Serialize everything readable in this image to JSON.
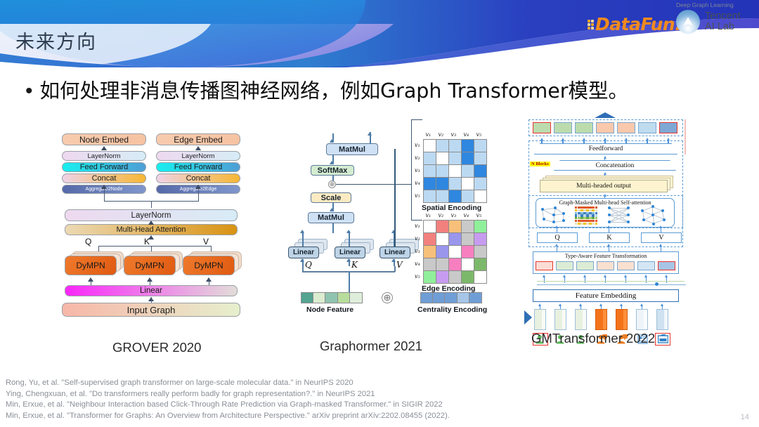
{
  "slide": {
    "title": "未来方向",
    "page_number": "14",
    "bullet_marker": "•",
    "bullet_text": "如何处理非消息传播图神经网络，例如Graph Transformer模型。"
  },
  "branding": {
    "datafun": {
      "name": "DataFun.",
      "lead": "D",
      "rest": "ataFun.",
      "color": "#f08a1e"
    },
    "tencent": {
      "tagline": "Deep Graph Learning",
      "line1": "Tencent",
      "line2": "AI Lab"
    }
  },
  "figures": {
    "grover": {
      "caption": "GROVER 2020",
      "left_column": [
        "Node Embed",
        "LayerNorm",
        "Feed Forward",
        "Concat",
        "Aggregate2Node"
      ],
      "right_column": [
        "Edge Embed",
        "LayerNorm",
        "Feed Forward",
        "Concat",
        "Aggregate2Edge"
      ],
      "shared": [
        "LayerNorm",
        "Multi-Head Attention"
      ],
      "qkv_labels": [
        "Q",
        "K",
        "V"
      ],
      "dympn": [
        "DyMPN",
        "DyMPN",
        "DyMPN"
      ],
      "linear": "Linear",
      "input": "Input Graph"
    },
    "graphormer": {
      "caption": "Graphormer 2021",
      "ops": [
        "MatMul",
        "SoftMax",
        "Scale",
        "MatMul"
      ],
      "linear_boxes": [
        "Linear",
        "Linear",
        "Linear"
      ],
      "qkv_labels": [
        "Q",
        "K",
        "V"
      ],
      "plus_symbols": [
        "⊕",
        "⊕"
      ],
      "node_feature_label": "Node Feature",
      "centrality_label": "Centrality Encoding",
      "spatial": {
        "caption": "Spatial Encoding",
        "row_labels": [
          "v₁",
          "v₂",
          "v₃",
          "v₄",
          "v₅"
        ],
        "col_labels": [
          "v₁",
          "v₂",
          "v₃",
          "v₄",
          "v₅"
        ],
        "cells": [
          [
            "#ffffff",
            "#bcd9f2",
            "#bcd9f2",
            "#2f87e0",
            "#bcd9f2"
          ],
          [
            "#bcd9f2",
            "#ffffff",
            "#bcd9f2",
            "#2f87e0",
            "#bcd9f2"
          ],
          [
            "#bcd9f2",
            "#bcd9f2",
            "#ffffff",
            "#bcd9f2",
            "#2f87e0"
          ],
          [
            "#2f87e0",
            "#2f87e0",
            "#bcd9f2",
            "#ffffff",
            "#bcd9f2"
          ],
          [
            "#bcd9f2",
            "#bcd9f2",
            "#2f87e0",
            "#bcd9f2",
            "#ffffff"
          ]
        ]
      },
      "edge": {
        "caption": "Edge Encoding",
        "row_labels": [
          "v₁",
          "v₂",
          "v₃",
          "v₄",
          "v₅"
        ],
        "col_labels": [
          "v₁",
          "v₂",
          "v₃",
          "v₄",
          "v₅"
        ],
        "cells": [
          [
            "#ffffff",
            "#f2807e",
            "#f7c07a",
            "#c9c9c9",
            "#90ef9a"
          ],
          [
            "#f2807e",
            "#ffffff",
            "#9a96ec",
            "#c9c9c9",
            "#c79cf0"
          ],
          [
            "#f7c07a",
            "#9a96ec",
            "#ffffff",
            "#f77fc0",
            "#c9c9c9"
          ],
          [
            "#c9c9c9",
            "#c9c9c9",
            "#f77fc0",
            "#ffffff",
            "#7cb86a"
          ],
          [
            "#90ef9a",
            "#c79cf0",
            "#c9c9c9",
            "#7cb86a",
            "#ffffff"
          ]
        ]
      },
      "node_feature_colors": [
        "#55a391",
        "#dcecd0",
        "#8fc4b0",
        "#b7dd9c",
        "#dfeedb"
      ],
      "centrality_colors": [
        "#6f9ed6",
        "#6f9ed6",
        "#6f9ed6",
        "#a6c6e8",
        "#6f9ed6"
      ]
    },
    "gmtransformer": {
      "caption": "GMTransformer 2022",
      "output_cells": [
        "#bcdcae",
        "#bcdcae",
        "#bcdcae",
        "#fac8ac",
        "#fac8ac",
        "#bfdcef",
        "#7fa8d4"
      ],
      "output_highlight": [
        0,
        6
      ],
      "feedforward": "Feedforward",
      "n_blocks": "N Blocks",
      "concatenation": "Concatenation",
      "multi_headed_output": "Multi-headed output",
      "attention_title": "Graph-Masked Multi-head Self-attention",
      "qkv": [
        "Q",
        "K",
        "V"
      ],
      "type_aware": "Type-Aware Feature Transformation",
      "type_cells": [
        "#fadcd4",
        "#dcecd4",
        "#dcecd4",
        "#fae0d0",
        "#fae0d0",
        "#d4e6f4",
        "#a8c4e4"
      ],
      "type_highlight": [
        0,
        6
      ],
      "feature_embedding": "Feature Embedding",
      "bars": [
        "#e8f0df",
        "#e8f0df",
        "#e8f0df",
        "#f4731a",
        "#f4731a",
        "#eef4fa",
        "#cfe2f2"
      ],
      "icon_names": [
        "user-icon",
        "user-icon",
        "user-icon",
        "user-chat-icon",
        "user-chat-icon",
        "news-icon",
        "ad-icon"
      ],
      "icon_colors": [
        "#5cb85c",
        "#5cb85c",
        "#5cb85c",
        "#ef7d22",
        "#ef7d22",
        "#5b9bd5",
        "#2f7fc4"
      ],
      "icon_highlight": [
        0,
        6
      ]
    }
  },
  "references": [
    "Rong, Yu, et al. \"Self-supervised graph transformer on large-scale molecular data.\" in NeurIPS 2020",
    "Ying, Chengxuan, et al. \"Do transformers really perform badly for graph representation?.\" in NeurIPS 2021",
    "Min, Erxue, et al. \"Neighbour Interaction based Click-Through Rate Prediction via Graph-masked Transformer.\" in SIGIR 2022",
    "Min, Erxue, et al. \"Transformer for Graphs: An Overview from Architecture Perspective.\" arXiv preprint arXiv:2202.08455 (2022)."
  ]
}
